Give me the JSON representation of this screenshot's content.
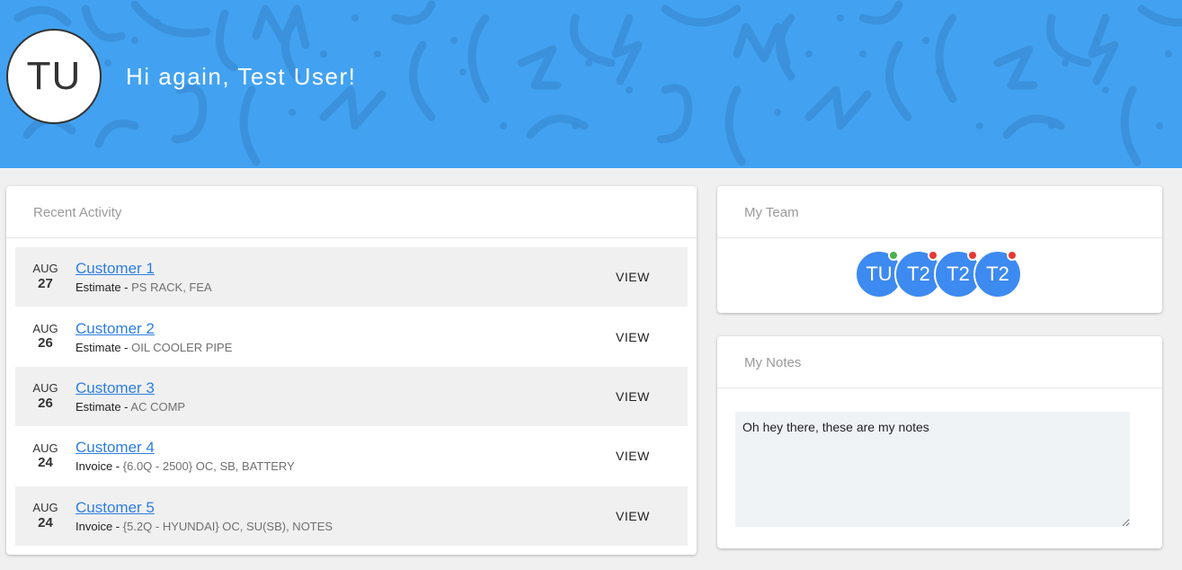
{
  "header": {
    "avatar_initials": "TU",
    "greeting": "Hi again, Test User!",
    "bg_color": "#42a2f1"
  },
  "recent_activity": {
    "title": "Recent Activity",
    "items": [
      {
        "month": "AUG",
        "day": "27",
        "customer": "Customer 1",
        "type": "Estimate -",
        "detail": "PS RACK, FEA",
        "action": "VIEW"
      },
      {
        "month": "AUG",
        "day": "26",
        "customer": "Customer 2",
        "type": "Estimate -",
        "detail": "OIL COOLER PIPE",
        "action": "VIEW"
      },
      {
        "month": "AUG",
        "day": "26",
        "customer": "Customer 3",
        "type": "Estimate -",
        "detail": "AC COMP",
        "action": "VIEW"
      },
      {
        "month": "AUG",
        "day": "24",
        "customer": "Customer 4",
        "type": "Invoice -",
        "detail": "{6.0Q - 2500} OC, SB, BATTERY",
        "action": "VIEW"
      },
      {
        "month": "AUG",
        "day": "24",
        "customer": "Customer 5",
        "type": "Invoice -",
        "detail": "{5.2Q - HYUNDAI} OC, SU(SB), NOTES",
        "action": "VIEW"
      }
    ]
  },
  "team": {
    "title": "My Team",
    "members": [
      {
        "initials": "TU",
        "status_color": "#4caf50"
      },
      {
        "initials": "T2",
        "status_color": "#e53935"
      },
      {
        "initials": "T2",
        "status_color": "#e53935"
      },
      {
        "initials": "T2",
        "status_color": "#e53935"
      }
    ]
  },
  "notes": {
    "title": "My Notes",
    "value": "Oh hey there, these are my notes"
  }
}
